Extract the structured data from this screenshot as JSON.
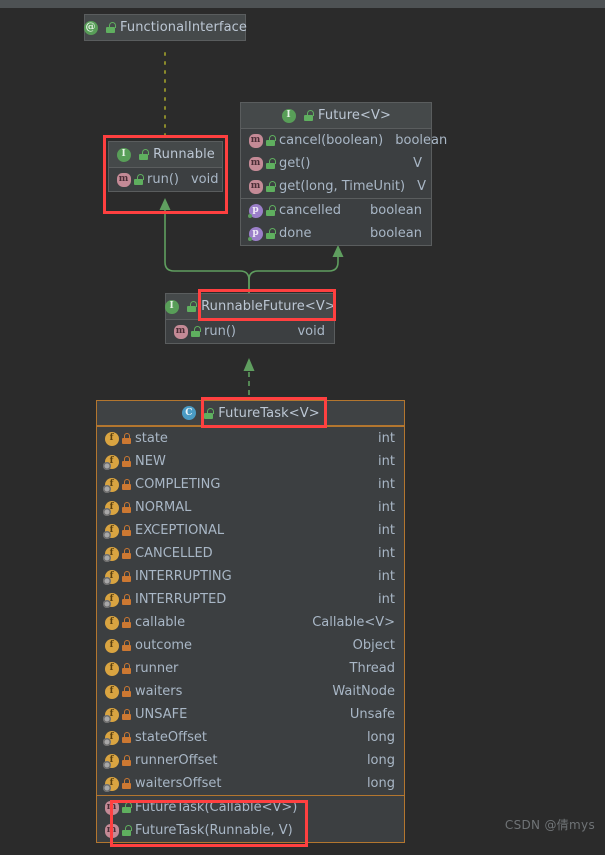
{
  "watermark": "CSDN @倩mys",
  "diagram": {
    "type": "uml-class-diagram",
    "nodes": [
      {
        "id": "functional-interface",
        "title": "FunctionalInterface",
        "kind": "annotation",
        "icon": "annotation-icon",
        "visibility": "public",
        "members": []
      },
      {
        "id": "runnable",
        "title": "Runnable",
        "kind": "interface",
        "icon": "interface-icon",
        "visibility": "public",
        "highlighted": true,
        "members": [
          {
            "icon": "method-icon",
            "visibility": "public",
            "name": "run()",
            "type": "void"
          }
        ]
      },
      {
        "id": "future",
        "title": "Future<V>",
        "kind": "interface",
        "icon": "interface-icon",
        "visibility": "public",
        "methods": [
          {
            "icon": "method-icon",
            "visibility": "public",
            "name": "cancel(boolean)",
            "type": "boolean"
          },
          {
            "icon": "method-icon",
            "visibility": "public",
            "name": "get()",
            "type": "V"
          },
          {
            "icon": "method-icon",
            "visibility": "public",
            "name": "get(long, TimeUnit)",
            "type": "V"
          }
        ],
        "properties": [
          {
            "icon": "property-icon",
            "visibility": "public",
            "name": "cancelled",
            "type": "boolean"
          },
          {
            "icon": "property-icon",
            "visibility": "public",
            "name": "done",
            "type": "boolean"
          }
        ]
      },
      {
        "id": "runnable-future",
        "title": "RunnableFuture<V>",
        "kind": "interface",
        "icon": "interface-icon",
        "visibility": "public",
        "highlighted": true,
        "members": [
          {
            "icon": "method-icon",
            "visibility": "public",
            "name": "run()",
            "type": "void"
          }
        ]
      },
      {
        "id": "future-task",
        "title": "FutureTask<V>",
        "kind": "class",
        "icon": "class-icon",
        "visibility": "public",
        "highlighted": true,
        "fields": [
          {
            "icon": "field-icon",
            "visibility": "private",
            "name": "state",
            "type": "int"
          },
          {
            "icon": "static-field-icon",
            "visibility": "private",
            "name": "NEW",
            "type": "int"
          },
          {
            "icon": "static-field-icon",
            "visibility": "private",
            "name": "COMPLETING",
            "type": "int"
          },
          {
            "icon": "static-field-icon",
            "visibility": "private",
            "name": "NORMAL",
            "type": "int"
          },
          {
            "icon": "static-field-icon",
            "visibility": "private",
            "name": "EXCEPTIONAL",
            "type": "int"
          },
          {
            "icon": "static-field-icon",
            "visibility": "private",
            "name": "CANCELLED",
            "type": "int"
          },
          {
            "icon": "static-field-icon",
            "visibility": "private",
            "name": "INTERRUPTING",
            "type": "int"
          },
          {
            "icon": "static-field-icon",
            "visibility": "private",
            "name": "INTERRUPTED",
            "type": "int"
          },
          {
            "icon": "field-icon",
            "visibility": "private",
            "name": "callable",
            "type": "Callable<V>"
          },
          {
            "icon": "field-icon",
            "visibility": "private",
            "name": "outcome",
            "type": "Object"
          },
          {
            "icon": "field-icon",
            "visibility": "private",
            "name": "runner",
            "type": "Thread"
          },
          {
            "icon": "field-icon",
            "visibility": "private",
            "name": "waiters",
            "type": "WaitNode"
          },
          {
            "icon": "static-field-icon",
            "visibility": "private",
            "name": "UNSAFE",
            "type": "Unsafe"
          },
          {
            "icon": "static-field-icon",
            "visibility": "private",
            "name": "stateOffset",
            "type": "long"
          },
          {
            "icon": "static-field-icon",
            "visibility": "private",
            "name": "runnerOffset",
            "type": "long"
          },
          {
            "icon": "static-field-icon",
            "visibility": "private",
            "name": "waitersOffset",
            "type": "long"
          }
        ],
        "constructors": [
          {
            "icon": "method-icon",
            "visibility": "public",
            "name": "FutureTask(Callable<V>)",
            "type": ""
          },
          {
            "icon": "method-icon",
            "visibility": "public",
            "name": "FutureTask(Runnable, V)",
            "type": ""
          }
        ]
      }
    ],
    "edges": [
      {
        "from": "runnable",
        "to": "functional-interface",
        "style": "dotted",
        "color": "#8a8a2b",
        "relation": "annotated-by"
      },
      {
        "from": "runnable-future",
        "to": "runnable",
        "style": "solid",
        "color": "#5f9e5f",
        "relation": "extends"
      },
      {
        "from": "runnable-future",
        "to": "future",
        "style": "solid",
        "color": "#5f9e5f",
        "relation": "extends"
      },
      {
        "from": "future-task",
        "to": "runnable-future",
        "style": "dashed",
        "color": "#5f9e5f",
        "relation": "implements"
      }
    ],
    "colors": {
      "background": "#2b2b2b",
      "node_bg": "#3c3f41",
      "node_border": "#5a5d5e",
      "class_border": "#b3762f",
      "text": "#a9b7c6",
      "highlight": "#ff4040",
      "inherit_arrow": "#5f9e5f",
      "annotation_line": "#8a8a2b"
    }
  }
}
